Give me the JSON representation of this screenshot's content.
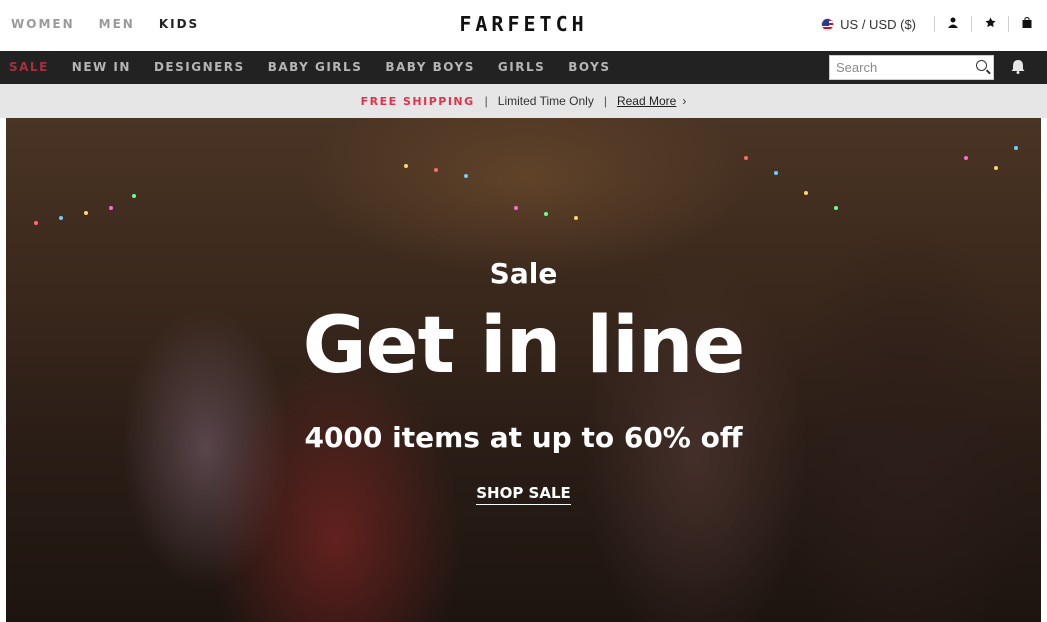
{
  "header": {
    "gender_nav": [
      "WOMEN",
      "MEN",
      "KIDS"
    ],
    "active_gender": "KIDS",
    "logo": "FARFETCH",
    "currency": "US / USD ($)",
    "icons": [
      "account-icon",
      "wishlist-star-icon",
      "bag-icon"
    ]
  },
  "category_nav": {
    "items": [
      "SALE",
      "NEW IN",
      "DESIGNERS",
      "BABY GIRLS",
      "BABY BOYS",
      "GIRLS",
      "BOYS"
    ],
    "sale_color": "#a4323a"
  },
  "search": {
    "placeholder": "Search"
  },
  "promo": {
    "free_shipping": "FREE SHIPPING",
    "separator": "|",
    "limited": "Limited Time Only",
    "read_more": "Read More",
    "chevron": "›"
  },
  "hero": {
    "eyebrow": "Sale",
    "title": "Get in line",
    "subtitle": "4000 items at up to 60% off",
    "cta": "SHOP SALE"
  },
  "colors": {
    "accent": "#e0334c",
    "nav_bg": "#222222",
    "promo_bg": "#e6e6e6"
  }
}
